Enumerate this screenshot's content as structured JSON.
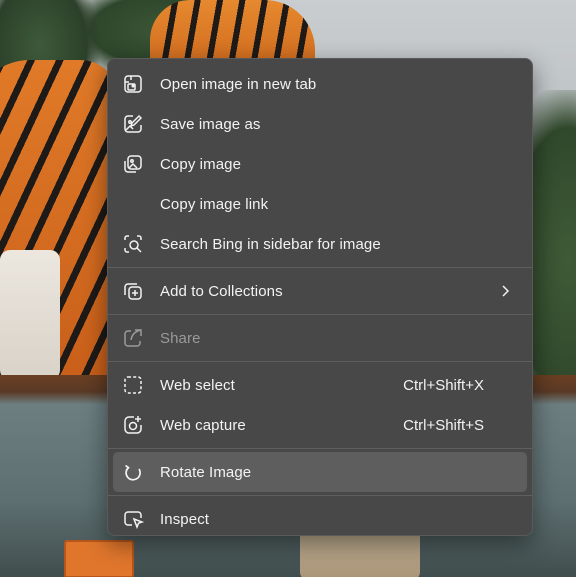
{
  "background": {
    "description_colors": {
      "tiger_orange": "#e07a28",
      "foliage": "#3d5a3a",
      "sky": "#c9cdcf"
    }
  },
  "context_menu": {
    "colors": {
      "background": "#484848",
      "hover": "#5e5e5e",
      "text": "#f3f3f3",
      "disabled_text": "#9a9a9a"
    },
    "items": [
      {
        "label": "Open image in new tab",
        "icon": "open-in-new-tab-icon"
      },
      {
        "label": "Save image as",
        "icon": "save-image-icon"
      },
      {
        "label": "Copy image",
        "icon": "copy-image-icon"
      },
      {
        "label": "Copy image link",
        "icon": ""
      },
      {
        "label": "Search Bing in sidebar for image",
        "icon": "visual-search-icon"
      },
      {
        "label": "Add to Collections",
        "icon": "collections-icon",
        "submenu": true
      },
      {
        "label": "Share",
        "icon": "share-icon",
        "disabled": true
      },
      {
        "label": "Web select",
        "icon": "web-select-icon",
        "shortcut": "Ctrl+Shift+X"
      },
      {
        "label": "Web capture",
        "icon": "web-capture-icon",
        "shortcut": "Ctrl+Shift+S"
      },
      {
        "label": "Rotate Image",
        "icon": "rotate-icon",
        "hovered": true
      },
      {
        "label": "Inspect",
        "icon": "inspect-icon"
      }
    ]
  }
}
